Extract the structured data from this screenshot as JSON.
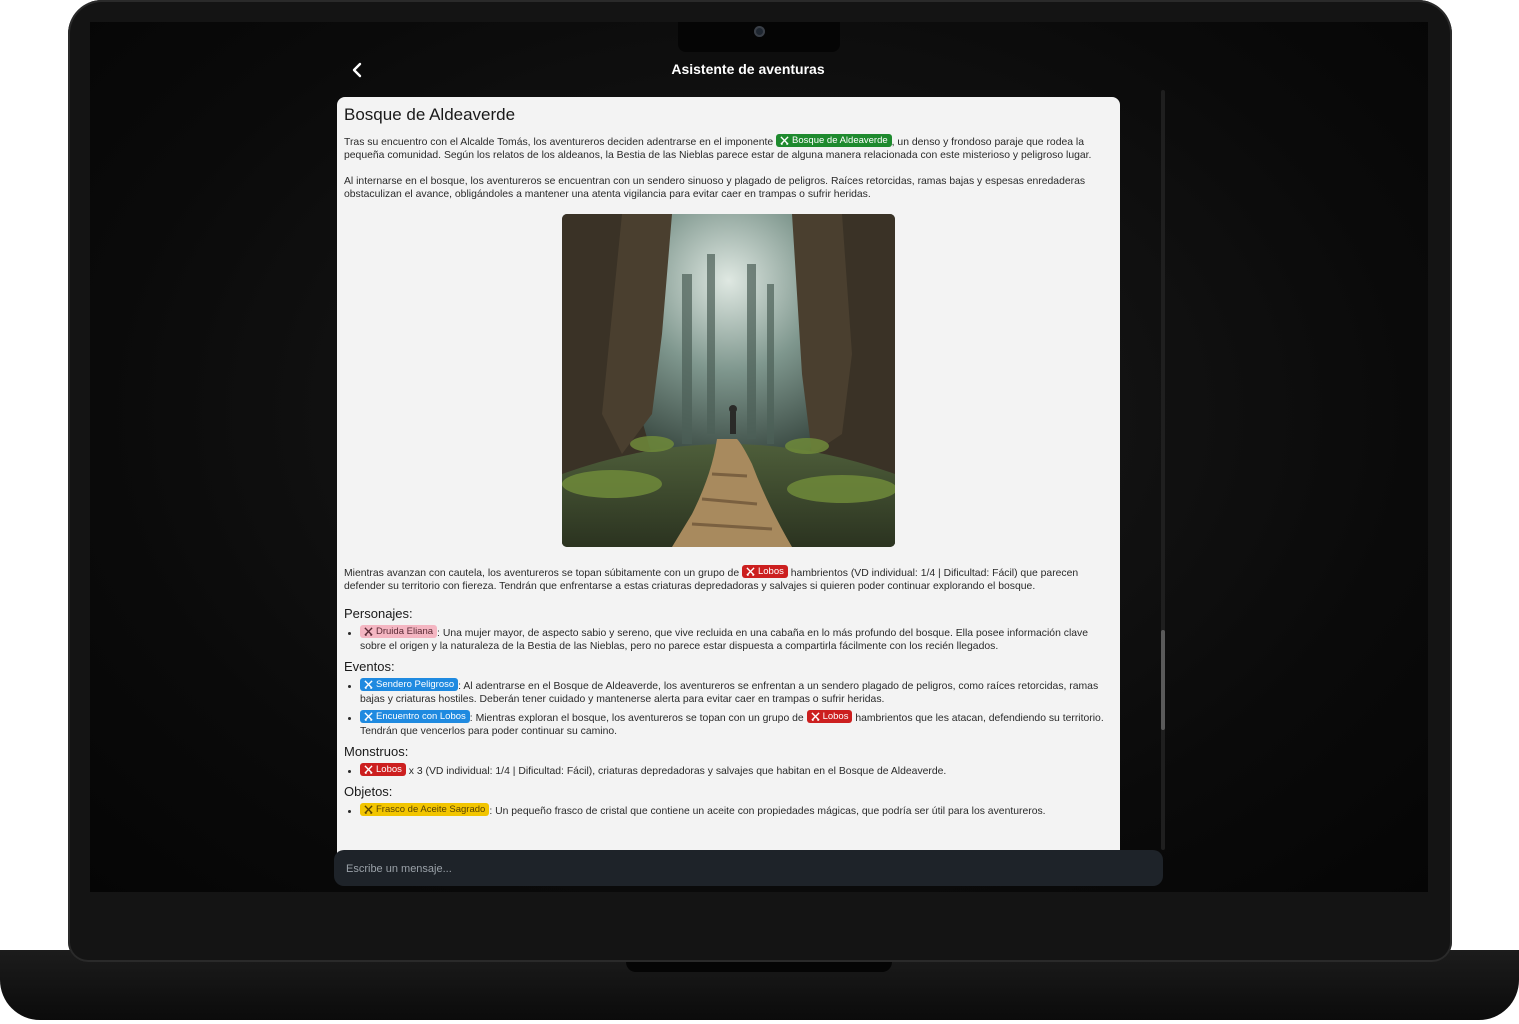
{
  "app": {
    "title": "Asistente de aventuras",
    "back_icon": "chevron-left-icon"
  },
  "scene": {
    "title": "Bosque de Aldeaverde",
    "intro_p1_before": "Tras su encuentro con el Alcalde Tomás, los aventureros deciden adentrarse en el imponente ",
    "intro_p1_tag": "Bosque de Aldeaverde",
    "intro_p1_after": ", un denso y frondoso paraje que rodea la pequeña comunidad. Según los relatos de los aldeanos, la Bestia de las Nieblas parece estar de alguna manera relacionada con este misterioso y peligroso lugar.",
    "intro_p2": "Al internarse en el bosque, los aventureros se encuentran con un sendero sinuoso y plagado de peligros. Raíces retorcidas, ramas bajas y espesas enredaderas obstaculizan el avance, obligándoles a mantener una atenta vigilancia para evitar caer en trampas o sufrir heridas.",
    "after_img_before": "Mientras avanzan con cautela, los aventureros se topan súbitamente con un grupo de ",
    "after_img_tag": "Lobos",
    "after_img_after": " hambrientos (VD individual: 1/4 | Dificultad: Fácil) que parecen defender su territorio con fiereza. Tendrán que enfrentarse a estas criaturas depredadoras y salvajes si quieren poder continuar explorando el bosque."
  },
  "sections": {
    "personajes": {
      "heading": "Personajes:",
      "item1_tag": "Druida Eliana",
      "item1_text": ": Una mujer mayor, de aspecto sabio y sereno, que vive recluida en una cabaña en lo más profundo del bosque. Ella posee información clave sobre el origen y la naturaleza de la Bestia de las Nieblas, pero no parece estar dispuesta a compartirla fácilmente con los recién llegados."
    },
    "eventos": {
      "heading": "Eventos:",
      "item1_tag": "Sendero Peligroso",
      "item1_text": ": Al adentrarse en el Bosque de Aldeaverde, los aventureros se enfrentan a un sendero plagado de peligros, como raíces retorcidas, ramas bajas y criaturas hostiles. Deberán tener cuidado y mantenerse alerta para evitar caer en trampas o sufrir heridas.",
      "item2_tag": "Encuentro con Lobos",
      "item2_text_before": ": Mientras exploran el bosque, los aventureros se topan con un grupo de ",
      "item2_tag2": "Lobos",
      "item2_text_after": " hambrientos que les atacan, defendiendo su territorio. Tendrán que vencerlos para poder continuar su camino."
    },
    "monstruos": {
      "heading": "Monstruos:",
      "item1_tag": "Lobos",
      "item1_text": " x 3 (VD individual: 1/4 | Dificultad: Fácil), criaturas depredadoras y salvajes que habitan en el Bosque de Aldeaverde."
    },
    "objetos": {
      "heading": "Objetos:",
      "item1_tag": "Frasco de Aceite Sagrado",
      "item1_text": ": Un pequeño frasco de cristal que contiene un aceite con propiedades mágicas, que podría ser útil para los aventureros."
    }
  },
  "composer": {
    "placeholder": "Escribe un mensaje..."
  },
  "colors": {
    "tag_location": "#1e8a2e",
    "tag_monster": "#cc1f1f",
    "tag_event": "#1f8ae0",
    "tag_character": "#f4b6c2",
    "tag_item": "#f2c500",
    "card_bg": "#f3f3f3",
    "composer_bg": "#1e2329"
  }
}
